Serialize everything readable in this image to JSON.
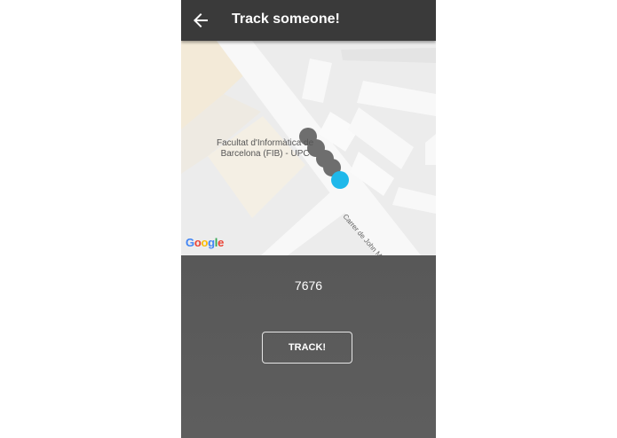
{
  "appbar": {
    "title": "Track someone!",
    "back_icon": "arrow-back-icon"
  },
  "map": {
    "place_label_line1": "Facultat d'Informàtica de",
    "place_label_line2": "Barcelona (FIB) - UPC",
    "street_label": "Carrer de John Maynard Keynes",
    "logo_letters": [
      "G",
      "o",
      "o",
      "g",
      "l",
      "e"
    ]
  },
  "tracking": {
    "code": "7676",
    "track_label": "TRACK!"
  },
  "colors": {
    "appbar": "#3a3a3a",
    "background": "#585858",
    "current_location": "#1fb8ea",
    "trail_point": "#6e6e6e"
  }
}
